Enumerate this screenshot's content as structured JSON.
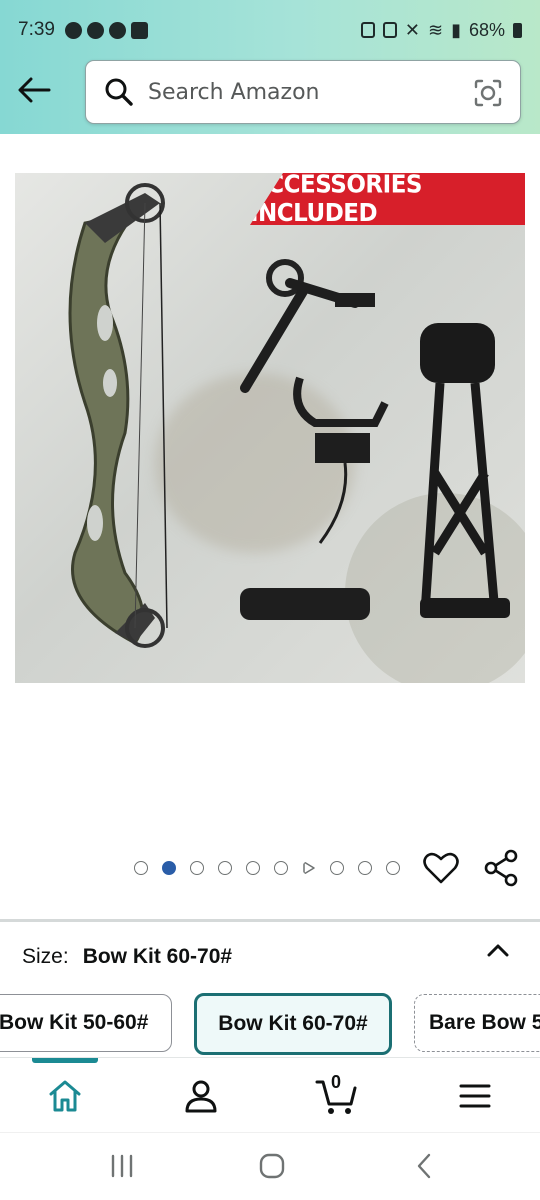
{
  "status_bar": {
    "time": "7:39",
    "battery": "68%"
  },
  "search": {
    "placeholder": "Search Amazon"
  },
  "product_image": {
    "banner_text": "ACCESSORIES INCLUDED"
  },
  "carousel": {
    "total_items": 10,
    "active_index": 1,
    "video_index": 6
  },
  "size": {
    "label": "Size:",
    "selected": "Bow Kit 60-70#",
    "options": [
      "Bow Kit 50-60#",
      "Bow Kit 60-70#",
      "Bare Bow 5"
    ]
  },
  "bottom_nav": {
    "cart_count": "0",
    "items": [
      "home-icon",
      "account-icon",
      "cart-icon",
      "menu-icon"
    ]
  },
  "colors": {
    "header_gradient_start": "#86d8d3",
    "header_gradient_end": "#b9e8c9",
    "banner_red": "#d71f2a",
    "accent_teal": "#1b6f73",
    "active_dot": "#2a5da8"
  }
}
